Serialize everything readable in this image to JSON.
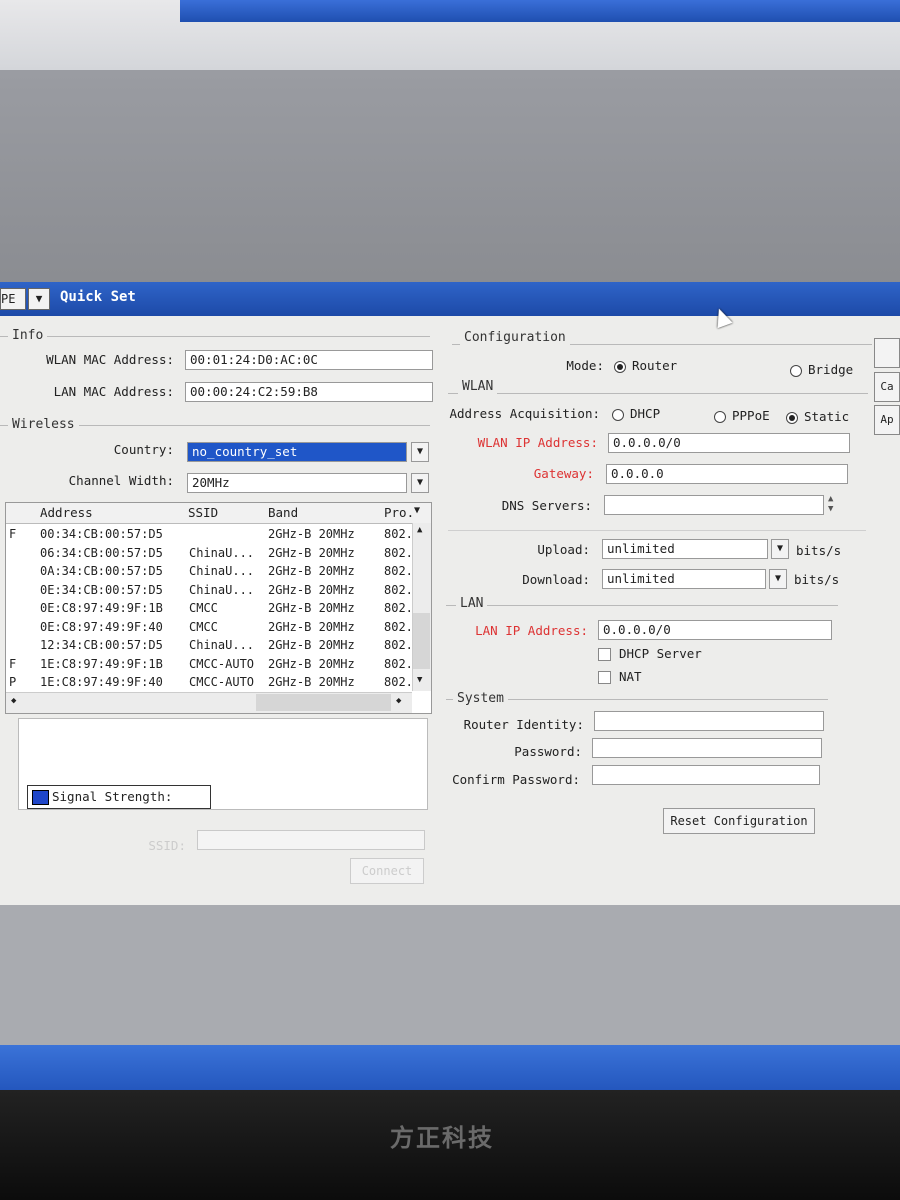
{
  "window": {
    "title": "Quick Set",
    "profile": "PE",
    "right_buttons": [
      "",
      "Ca",
      "Ap"
    ]
  },
  "info": {
    "title": "Info",
    "wlan_mac_label": "WLAN MAC Address:",
    "wlan_mac_value": "00:01:24:D0:AC:0C",
    "lan_mac_label": "LAN MAC Address:",
    "lan_mac_value": "00:00:24:C2:59:B8"
  },
  "wireless": {
    "title": "Wireless",
    "country_label": "Country:",
    "country_value": "no_country_set",
    "channel_width_label": "Channel Width:",
    "channel_width_value": "20MHz",
    "columns": [
      "Address",
      "SSID",
      "Band",
      "Pro."
    ],
    "rows": [
      {
        "flag": "F",
        "address": "00:34:CB:00:57:D5",
        "ssid": "",
        "band": "2GHz-B 20MHz",
        "pro": "802."
      },
      {
        "flag": "",
        "address": "06:34:CB:00:57:D5",
        "ssid": "ChinaU...",
        "band": "2GHz-B 20MHz",
        "pro": "802."
      },
      {
        "flag": "",
        "address": "0A:34:CB:00:57:D5",
        "ssid": "ChinaU...",
        "band": "2GHz-B 20MHz",
        "pro": "802."
      },
      {
        "flag": "",
        "address": "0E:34:CB:00:57:D5",
        "ssid": "ChinaU...",
        "band": "2GHz-B 20MHz",
        "pro": "802."
      },
      {
        "flag": "",
        "address": "0E:C8:97:49:9F:1B",
        "ssid": "CMCC",
        "band": "2GHz-B 20MHz",
        "pro": "802."
      },
      {
        "flag": "",
        "address": "0E:C8:97:49:9F:40",
        "ssid": "CMCC",
        "band": "2GHz-B 20MHz",
        "pro": "802."
      },
      {
        "flag": "",
        "address": "12:34:CB:00:57:D5",
        "ssid": "ChinaU...",
        "band": "2GHz-B 20MHz",
        "pro": "802."
      },
      {
        "flag": "F",
        "address": "1E:C8:97:49:9F:1B",
        "ssid": "CMCC-AUTO",
        "band": "2GHz-B 20MHz",
        "pro": "802."
      },
      {
        "flag": "P",
        "address": "1E:C8:97:49:9F:40",
        "ssid": "CMCC-AUTO",
        "band": "2GHz-B 20MHz",
        "pro": "802."
      }
    ],
    "signal_legend": "Signal Strength:",
    "ssid_label": "SSID:",
    "ssid_value": "",
    "connect_label": "Connect"
  },
  "configuration": {
    "title": "Configuration",
    "mode_label": "Mode:",
    "mode_router": "Router",
    "mode_bridge": "Bridge"
  },
  "wlan": {
    "title": "WLAN",
    "acq_label": "Address Acquisition:",
    "acq_dhcp": "DHCP",
    "acq_pppoe": "PPPoE",
    "acq_static": "Static",
    "ip_label": "WLAN IP Address:",
    "ip_value": "0.0.0.0/0",
    "gateway_label": "Gateway:",
    "gateway_value": "0.0.0.0",
    "dns_label": "DNS Servers:",
    "dns_value": "",
    "upload_label": "Upload:",
    "upload_value": "unlimited",
    "download_label": "Download:",
    "download_value": "unlimited",
    "unit": "bits/s"
  },
  "lan": {
    "title": "LAN",
    "ip_label": "LAN IP Address:",
    "ip_value": "0.0.0.0/0",
    "dhcp_server": "DHCP Server",
    "nat": "NAT"
  },
  "system": {
    "title": "System",
    "identity_label": "Router Identity:",
    "password_label": "Password:",
    "confirm_label": "Confirm Password:",
    "reset_label": "Reset Configuration"
  },
  "monitor_brand": "方正科技"
}
